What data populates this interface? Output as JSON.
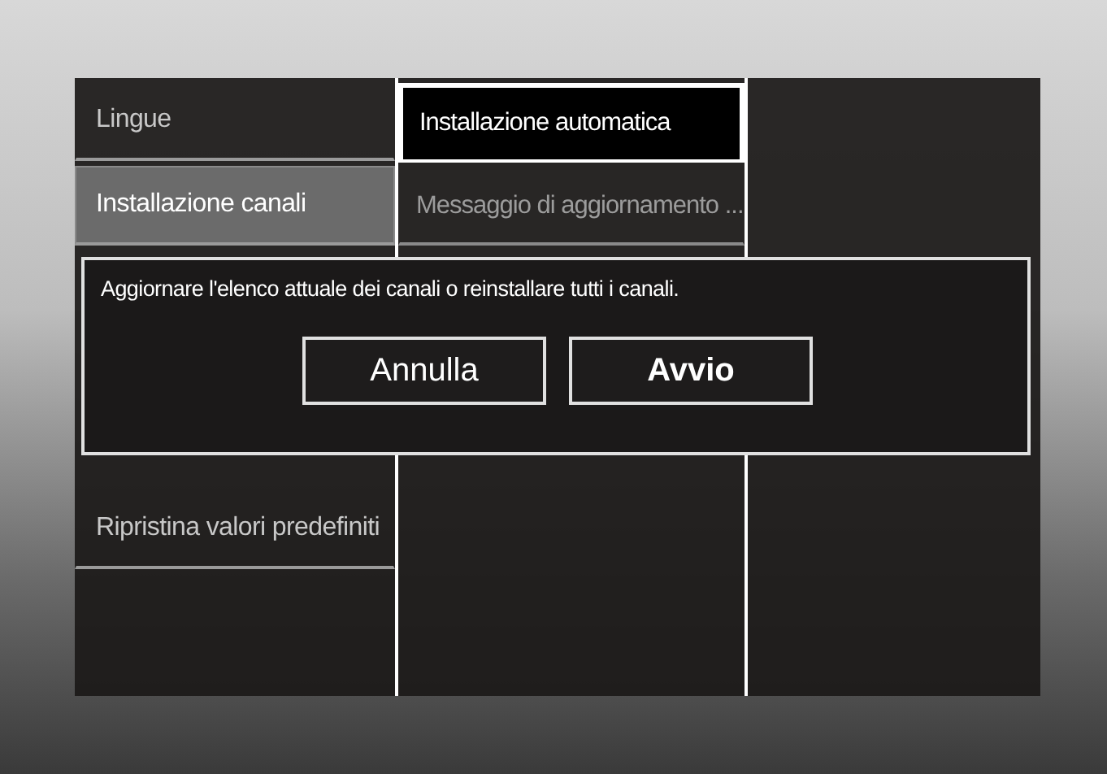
{
  "menu": {
    "items": [
      {
        "label": "Lingue",
        "selected": false
      },
      {
        "label": "Installazione canali",
        "selected": true
      },
      {
        "label": "Ripristina valori predefiniti",
        "selected": false
      }
    ]
  },
  "submenu": {
    "items": [
      {
        "label": "Installazione automatica",
        "selected": true
      },
      {
        "label": "Messaggio di aggiornamento ...",
        "selected": false
      }
    ]
  },
  "dialog": {
    "message": "Aggiornare l'elenco attuale dei canali o reinstallare tutti i canali.",
    "buttons": [
      {
        "label": "Annulla",
        "selected": false
      },
      {
        "label": "Avvio",
        "selected": true
      }
    ]
  }
}
